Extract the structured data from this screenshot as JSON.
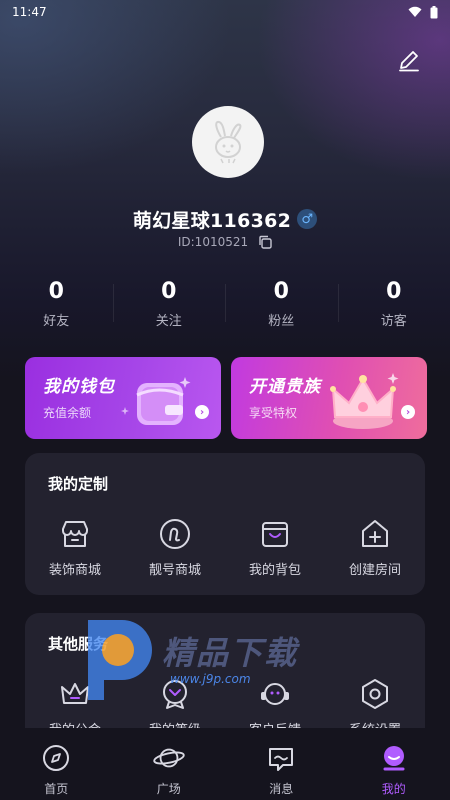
{
  "status_bar": {
    "time": "11:47"
  },
  "profile": {
    "name": "萌幻星球116362",
    "gender_symbol": "♂",
    "id_text": "ID:1010521"
  },
  "stats": [
    {
      "value": "0",
      "label": "好友"
    },
    {
      "value": "0",
      "label": "关注"
    },
    {
      "value": "0",
      "label": "粉丝"
    },
    {
      "value": "0",
      "label": "访客"
    }
  ],
  "cards": {
    "wallet": {
      "title": "我的钱包",
      "subtitle": "充值余额",
      "arrow": "›"
    },
    "noble": {
      "title": "开通贵族",
      "subtitle": "享受特权",
      "arrow": "›"
    }
  },
  "custom_section": {
    "title": "我的定制",
    "items": [
      {
        "label": "装饰商城",
        "icon": "shop-icon"
      },
      {
        "label": "靓号商城",
        "icon": "number-shop-icon"
      },
      {
        "label": "我的背包",
        "icon": "backpack-icon"
      },
      {
        "label": "创建房间",
        "icon": "create-room-icon"
      }
    ]
  },
  "other_section": {
    "title": "其他服务",
    "items": [
      {
        "label": "我的公会",
        "icon": "guild-icon"
      },
      {
        "label": "我的等级",
        "icon": "level-icon"
      },
      {
        "label": "客户反馈",
        "icon": "feedback-icon"
      },
      {
        "label": "系统设置",
        "icon": "settings-icon"
      }
    ]
  },
  "watermark": {
    "text": "精品下载",
    "url": "www.j9p.com"
  },
  "tabbar": {
    "items": [
      {
        "label": "首页",
        "icon": "compass-icon"
      },
      {
        "label": "广场",
        "icon": "planet-icon"
      },
      {
        "label": "消息",
        "icon": "message-icon"
      },
      {
        "label": "我的",
        "icon": "profile-icon"
      }
    ],
    "active_index": 3
  },
  "colors": {
    "accent": "#b05cff",
    "panel_bg": "#23222f",
    "page_bg": "#15141e"
  }
}
